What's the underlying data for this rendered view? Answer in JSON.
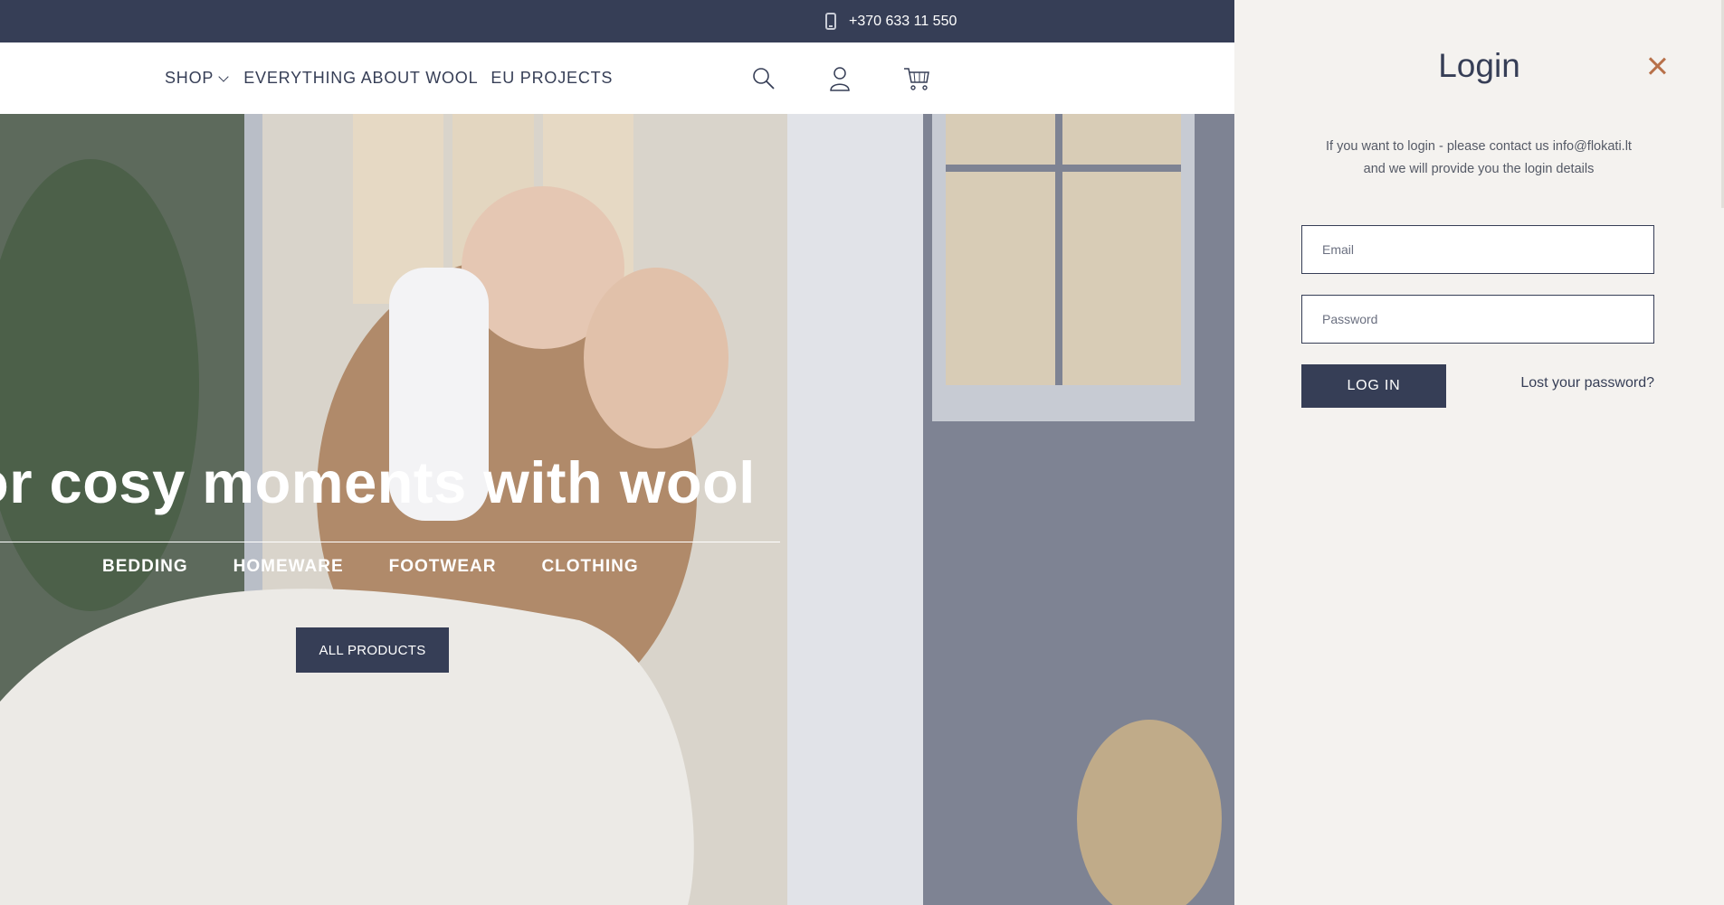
{
  "topbar": {
    "phone": "+370 633 11 550",
    "phone_icon": "mobile-phone-icon"
  },
  "nav": {
    "shop": "SHOP",
    "wool": "EVERYTHING ABOUT WOOL",
    "eu": "EU PROJECTS",
    "icons": [
      "search-icon",
      "user-icon",
      "cart-icon"
    ]
  },
  "hero": {
    "title": "or cosy moments with wool",
    "categories": [
      "BEDDING",
      "HOMEWARE",
      "FOOTWEAR",
      "CLOTHING"
    ],
    "button": "ALL PRODUCTS"
  },
  "login": {
    "title": "Login",
    "message_line1": "If you want to login - please contact us info@flokati.lt",
    "message_line2": "and we will provide you the login details",
    "email_placeholder": "Email",
    "password_placeholder": "Password",
    "login_button": "LOG IN",
    "lost_password": "Lost your password?"
  },
  "colors": {
    "navy": "#363e56",
    "drawer_bg": "#f4f2ef",
    "close_accent": "#b8714a"
  }
}
